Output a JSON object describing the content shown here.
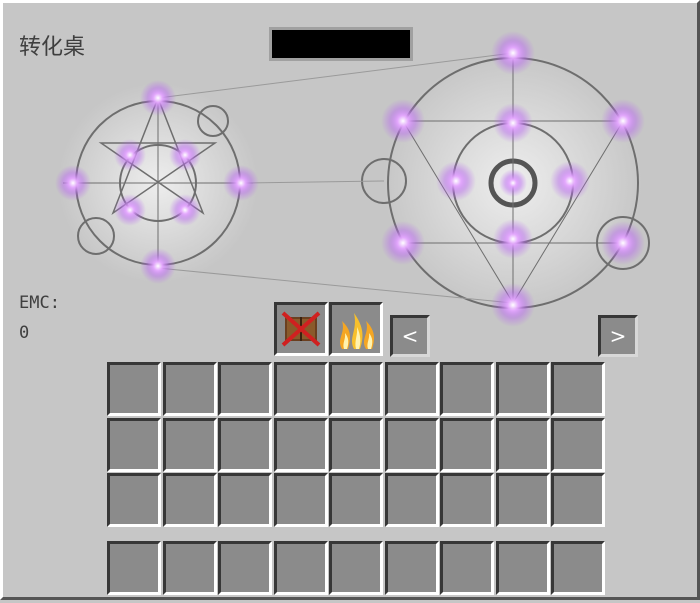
{
  "window": {
    "title": "转化桌"
  },
  "search": {
    "value": ""
  },
  "emc": {
    "label": "EMC:",
    "value": "0"
  },
  "nav": {
    "prev_label": "<",
    "next_label": ">"
  },
  "icons": {
    "burn": "burn-book-icon",
    "fire": "fire-icon"
  },
  "inventory": {
    "rows": 3,
    "cols": 9,
    "hotbar_cols": 9
  },
  "colors": {
    "panel": "#c6c6c6",
    "slot": "#8b8b8b",
    "glow": "#c76bff"
  }
}
